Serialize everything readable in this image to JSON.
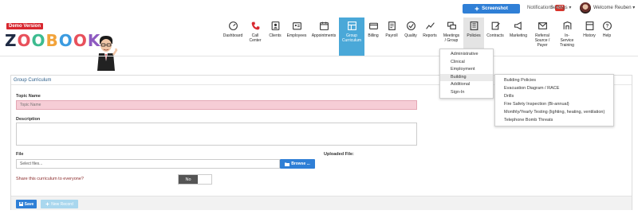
{
  "topbar": {
    "screenshot_label": "Screenshot",
    "notifications_label": "Notifications",
    "notifications_count": "437",
    "settings_label": "Settings",
    "welcome_label": "Welcome Reuben"
  },
  "logo": {
    "demo_tag": "Demo Version",
    "letters": [
      "Z",
      "O",
      "O",
      "B",
      "O",
      "O",
      "K"
    ]
  },
  "nav": {
    "items": [
      {
        "label": "Dashboard",
        "icon": "dashboard-icon"
      },
      {
        "label": "Call\nCenter",
        "icon": "phone-icon"
      },
      {
        "label": "Clients",
        "icon": "clients-icon"
      },
      {
        "label": "Employees",
        "icon": "employees-icon"
      },
      {
        "label": "Appointments",
        "icon": "calendar-icon"
      },
      {
        "label": "Group\nCurriculum",
        "icon": "group-curriculum-icon",
        "active": true
      },
      {
        "label": "Billing",
        "icon": "billing-icon"
      },
      {
        "label": "Payroll",
        "icon": "payroll-icon"
      },
      {
        "label": "Quality",
        "icon": "quality-icon"
      },
      {
        "label": "Reports",
        "icon": "reports-icon"
      },
      {
        "label": "Meetings\n/ Group",
        "icon": "meetings-icon"
      },
      {
        "label": "Policies",
        "icon": "policies-icon",
        "hover": true
      },
      {
        "label": "Contracts",
        "icon": "contracts-icon"
      },
      {
        "label": "Marketing",
        "icon": "marketing-icon"
      },
      {
        "label": "Referral\nSource /\nPayer",
        "icon": "referral-icon"
      },
      {
        "label": "In-\nService\nTraining",
        "icon": "training-icon"
      },
      {
        "label": "History",
        "icon": "history-icon"
      },
      {
        "label": "Help",
        "icon": "help-icon"
      }
    ]
  },
  "policies_menu": {
    "items": [
      "Administrative",
      "Clinical",
      "Employment",
      "Building",
      "Additional",
      "Sign-In"
    ],
    "selected": "Building"
  },
  "building_menu": {
    "items": [
      "Building Policies",
      "Evacuation Diagram / RACE",
      "Drills",
      "Fire Safety Inspection (Bi-annual)",
      "Monthly/Yearly Testing (lighting, heating, ventilation)",
      "Telephone Bomb Threats"
    ]
  },
  "form": {
    "panel_title": "Group Curriculum",
    "topic_label": "Topic Name",
    "topic_placeholder": "Topic Name",
    "description_label": "Description",
    "file_label": "File",
    "file_placeholder": "Select files...",
    "browse_label": "Browse ...",
    "uploaded_label": "Uploaded File:",
    "share_label": "Share this curriculum to everyone?",
    "toggle_value": "No",
    "save_label": "Save",
    "new_record_label": "New Record"
  },
  "colors": {
    "primary": "#2f7fd6",
    "active_nav": "#4aa8d8",
    "required_field": "#f6cdd6",
    "badge": "#d9342b"
  }
}
